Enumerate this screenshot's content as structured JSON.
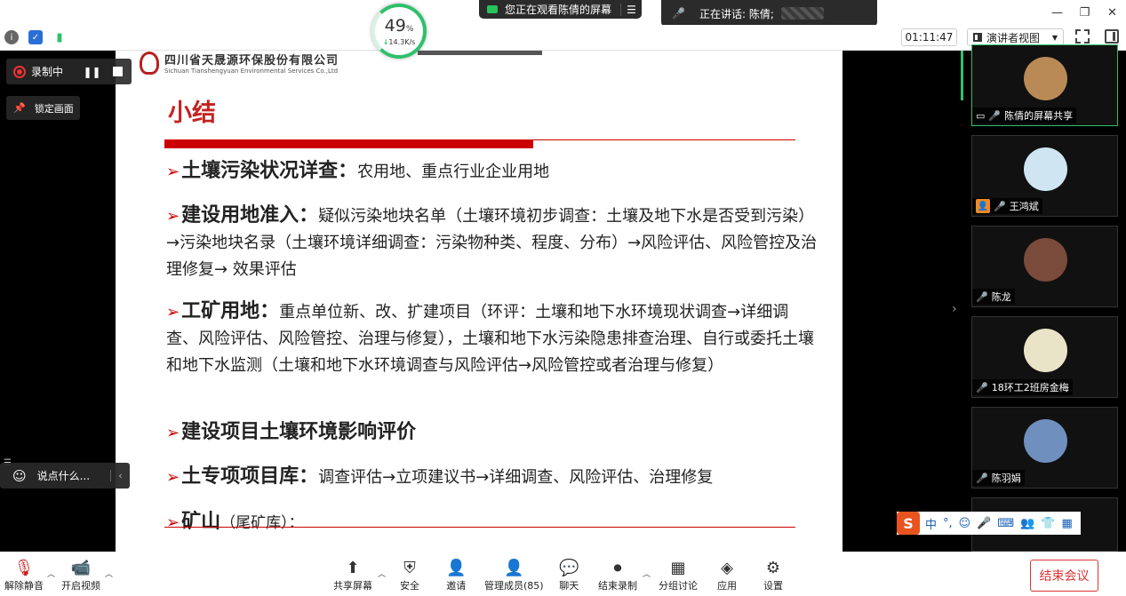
{
  "topbar": {
    "sharing_notice": "您正在观看陈倩的屏幕",
    "speaking_label": "正在讲话: 陈倩;"
  },
  "network": {
    "percent": "49",
    "percent_unit": "%",
    "speed": "14.3K/s"
  },
  "toolbar": {
    "timer": "01:11:47",
    "view_mode": "演讲者视图"
  },
  "recording": {
    "label": "录制中"
  },
  "lock_label": "锁定画面",
  "chat": {
    "placeholder": "说点什么..."
  },
  "slide": {
    "company_cn": "四川省天晟源环保股份有限公司",
    "company_en": "Sichuan Tianshengyuan Environmental Services Co.,Ltd",
    "title": "小结",
    "items": [
      {
        "head": "土壤污染状况详查：",
        "body": "农用地、重点行业企业用地"
      },
      {
        "head": "建设用地准入：",
        "body": "疑似污染地块名单（土壤环境初步调查：土壤及地下水是否受到污染）→污染地块名录（土壤环境详细调查：污染物种类、程度、分布）→风险评估、风险管控及治理修复→ 效果评估"
      },
      {
        "head": "工矿用地：",
        "body": "重点单位新、改、扩建项目（环评：土壤和地下水环境现状调查→详细调查、风险评估、风险管控、治理与修复），土壤和地下水污染隐患排查治理、自行或委托土壤和地下水监测（土壤和地下水环境调查与风险评估→风险管控或者治理与修复）"
      },
      {
        "head": "建设项目土壤环境影响评价",
        "body": ""
      },
      {
        "head": "土专项项目库：",
        "body": "调查评估→立项建议书→详细调查、风险评估、治理修复"
      },
      {
        "head": "矿山",
        "body": "（尾矿库）："
      }
    ]
  },
  "participants": [
    {
      "name": "陈倩的屏幕共享",
      "color": "#b98a55"
    },
    {
      "name": "王鸿斌",
      "color": "#cfe6f2"
    },
    {
      "name": "陈龙",
      "color": "#7a4a3a"
    },
    {
      "name": "18环工2班房金梅",
      "color": "#e9e4c8"
    },
    {
      "name": "陈羽娟",
      "color": "#6f8fbf"
    }
  ],
  "ime": {
    "lang": "中",
    "punct": "°,"
  },
  "bottombar": {
    "unmute": "解除静音",
    "video": "开启视频",
    "share": "共享屏幕",
    "security": "安全",
    "invite": "邀请",
    "members": "管理成员(85)",
    "chat": "聊天",
    "stop_record": "结束录制",
    "breakout": "分组讨论",
    "apps": "应用",
    "settings": "设置",
    "end": "结束会议"
  }
}
